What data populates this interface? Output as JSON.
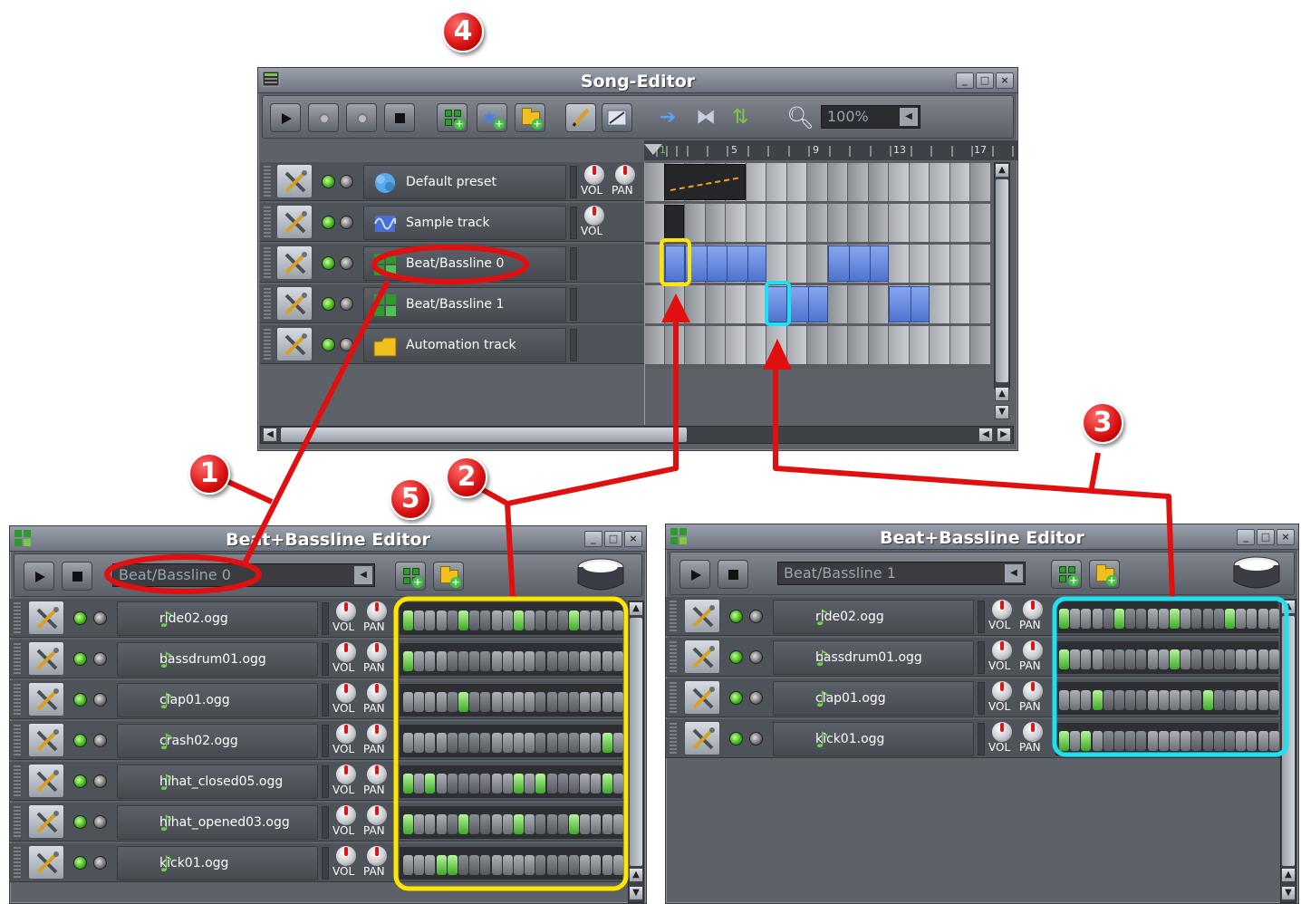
{
  "song_editor": {
    "title": "Song-Editor",
    "zoom": "100%",
    "ruler_marks": [
      "1",
      "5",
      "9",
      "13",
      "17"
    ],
    "tracks": [
      {
        "name": "Default preset",
        "type": "instrument",
        "knobs": [
          "VOL",
          "PAN"
        ]
      },
      {
        "name": "Sample track",
        "type": "sample",
        "knobs": [
          "VOL"
        ]
      },
      {
        "name": "Beat/Bassline 0",
        "type": "beat",
        "knobs": []
      },
      {
        "name": "Beat/Bassline 1",
        "type": "beat",
        "knobs": []
      },
      {
        "name": "Automation track",
        "type": "automation",
        "knobs": []
      }
    ]
  },
  "bb_editor_left": {
    "title": "Beat+Bassline Editor",
    "pattern": "Beat/Bassline 0",
    "tracks": [
      {
        "name": "ride02.ogg",
        "steps": [
          1,
          0,
          0,
          0,
          0,
          1,
          0,
          0,
          0,
          0,
          1,
          0,
          0,
          0,
          0,
          1,
          0,
          0,
          0,
          0
        ]
      },
      {
        "name": "bassdrum01.ogg",
        "steps": [
          1,
          0,
          0,
          0,
          0,
          0,
          0,
          0,
          0,
          0,
          0,
          0,
          0,
          0,
          0,
          0,
          0,
          0,
          0,
          0
        ]
      },
      {
        "name": "clap01.ogg",
        "steps": [
          0,
          0,
          0,
          0,
          0,
          1,
          0,
          0,
          0,
          0,
          0,
          0,
          0,
          0,
          0,
          0,
          0,
          0,
          0,
          0
        ]
      },
      {
        "name": "crash02.ogg",
        "steps": [
          0,
          0,
          0,
          0,
          0,
          0,
          0,
          0,
          0,
          0,
          0,
          0,
          0,
          0,
          0,
          0,
          0,
          0,
          1,
          0
        ]
      },
      {
        "name": "hihat_closed05.ogg",
        "steps": [
          1,
          0,
          1,
          0,
          0,
          0,
          0,
          0,
          0,
          0,
          1,
          0,
          1,
          0,
          0,
          0,
          0,
          0,
          1,
          0
        ]
      },
      {
        "name": "hihat_opened03.ogg",
        "steps": [
          1,
          0,
          0,
          0,
          0,
          1,
          0,
          0,
          0,
          0,
          1,
          0,
          0,
          0,
          0,
          1,
          0,
          0,
          0,
          0
        ]
      },
      {
        "name": "kick01.ogg",
        "steps": [
          0,
          0,
          0,
          1,
          1,
          0,
          0,
          0,
          0,
          0,
          0,
          0,
          0,
          0,
          0,
          0,
          0,
          0,
          0,
          0
        ]
      }
    ]
  },
  "bb_editor_right": {
    "title": "Beat+Bassline Editor",
    "pattern": "Beat/Bassline 1",
    "tracks": [
      {
        "name": "ride02.ogg",
        "steps": [
          1,
          0,
          0,
          0,
          0,
          1,
          0,
          0,
          0,
          0,
          1,
          0,
          0,
          0,
          0,
          1,
          0,
          0,
          0,
          0
        ]
      },
      {
        "name": "bassdrum01.ogg",
        "steps": [
          1,
          0,
          0,
          0,
          0,
          0,
          0,
          0,
          0,
          0,
          1,
          0,
          0,
          0,
          0,
          0,
          0,
          0,
          0,
          0
        ]
      },
      {
        "name": "clap01.ogg",
        "steps": [
          0,
          0,
          0,
          1,
          0,
          0,
          0,
          0,
          0,
          0,
          0,
          0,
          0,
          1,
          0,
          0,
          0,
          0,
          0,
          0
        ]
      },
      {
        "name": "kick01.ogg",
        "steps": [
          1,
          0,
          1,
          0,
          0,
          0,
          0,
          0,
          0,
          0,
          0,
          0,
          0,
          0,
          0,
          0,
          0,
          0,
          0,
          0
        ]
      }
    ]
  },
  "knob_labels": {
    "vol": "VOL",
    "pan": "PAN"
  },
  "callouts": [
    "1",
    "2",
    "3",
    "4",
    "5"
  ],
  "colors": {
    "callout": "#e01010",
    "yellow_highlight": "#ffe600",
    "cyan_highlight": "#1ee0f0",
    "clip_blue": "#5b82dc",
    "step_on": "#5fd33a"
  }
}
